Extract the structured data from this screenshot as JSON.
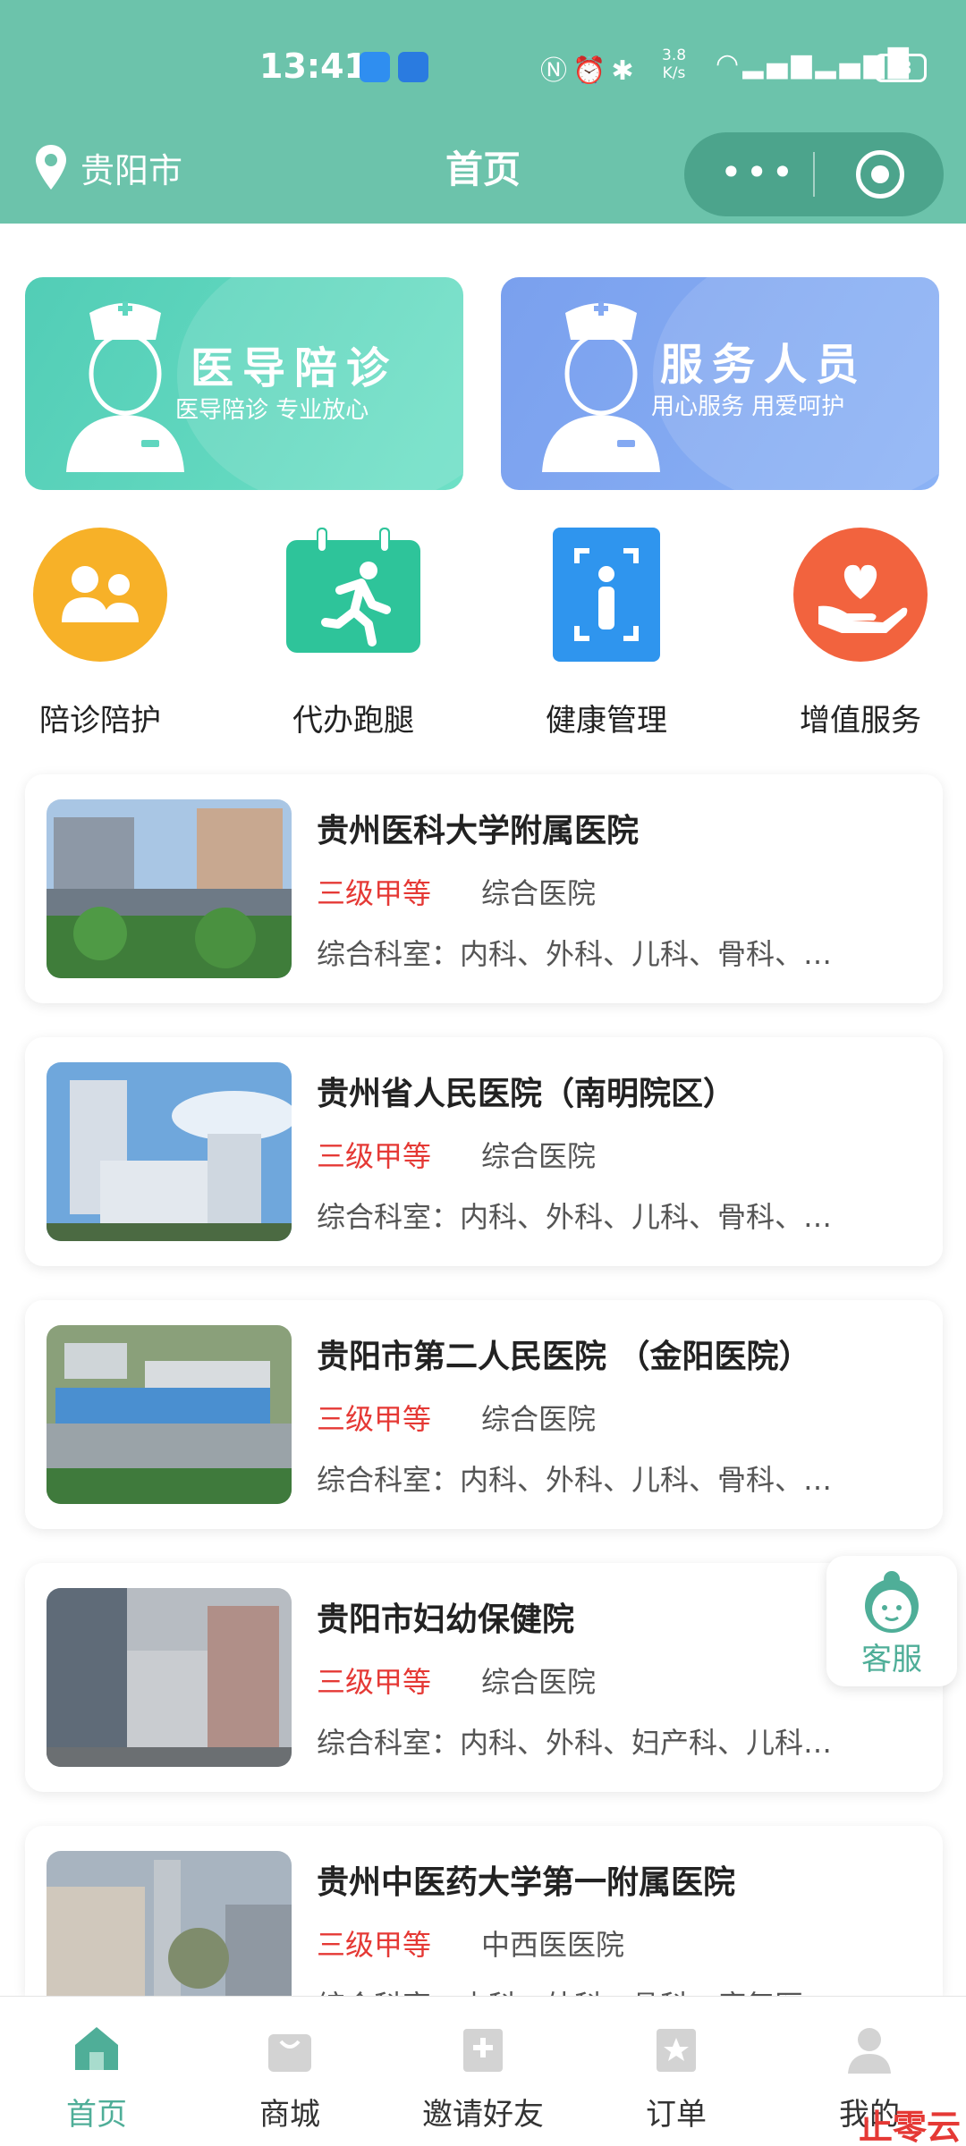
{
  "status_bar": {
    "time": "13:41",
    "speed_line1": "3.8",
    "speed_line2": "K/s",
    "battery": "73",
    "icons": [
      "nfc-icon",
      "alarm-icon",
      "bluetooth-icon",
      "wifi-icon",
      "signal-4g-icon",
      "signal-5g-icon"
    ]
  },
  "navbar": {
    "city": "贵阳市",
    "title": "首页",
    "more_icon": "more-dots-icon",
    "close_icon": "target-icon"
  },
  "banners": [
    {
      "title": "医导陪诊",
      "subtitle": "医导陪诊  专业放心",
      "color": "#5fd6bf"
    },
    {
      "title": "服务人员",
      "subtitle": "用心服务  用爱呵护",
      "color": "#84a9f2"
    }
  ],
  "quick_actions": [
    {
      "label": "陪诊陪护",
      "icon": "people-icon",
      "color": "#f7b128"
    },
    {
      "label": "代办跑腿",
      "icon": "runner-calendar-icon",
      "color": "#2ec49a"
    },
    {
      "label": "健康管理",
      "icon": "body-scan-icon",
      "color": "#2f95ee"
    },
    {
      "label": "增值服务",
      "icon": "heart-hand-icon",
      "color": "#f2633e"
    }
  ],
  "hospitals": [
    {
      "name": "贵州医科大学附属医院",
      "level": "三级甲等",
      "type": "综合医院",
      "depts": "综合科室：内科、外科、儿科、骨科、…"
    },
    {
      "name": "贵州省人民医院（南明院区）",
      "level": "三级甲等",
      "type": "综合医院",
      "depts": "综合科室：内科、外科、儿科、骨科、…"
    },
    {
      "name": "贵阳市第二人民医院 （金阳医院）",
      "level": "三级甲等",
      "type": "综合医院",
      "depts": "综合科室：内科、外科、儿科、骨科、…"
    },
    {
      "name": "贵阳市妇幼保健院",
      "level": "三级甲等",
      "type": "综合医院",
      "depts": "综合科室：内科、外科、妇产科、儿科…"
    },
    {
      "name": "贵州中医药大学第一附属医院",
      "level": "三级甲等",
      "type": "中西医医院",
      "depts": "综合科室：内科、外科、骨科、康复医…"
    }
  ],
  "floating_service": {
    "label": "客服",
    "icon": "customer-service-icon"
  },
  "tabbar": [
    {
      "label": "首页",
      "icon": "home-icon",
      "active": true
    },
    {
      "label": "商城",
      "icon": "shopping-bag-icon",
      "active": false
    },
    {
      "label": "邀请好友",
      "icon": "invite-icon",
      "active": false
    },
    {
      "label": "订单",
      "icon": "order-icon",
      "active": false
    },
    {
      "label": "我的",
      "icon": "profile-icon",
      "active": false
    }
  ],
  "watermark": "止零云",
  "colors": {
    "header": "#6cc3ab",
    "accent": "#4fae98",
    "level_red": "#e53935"
  }
}
